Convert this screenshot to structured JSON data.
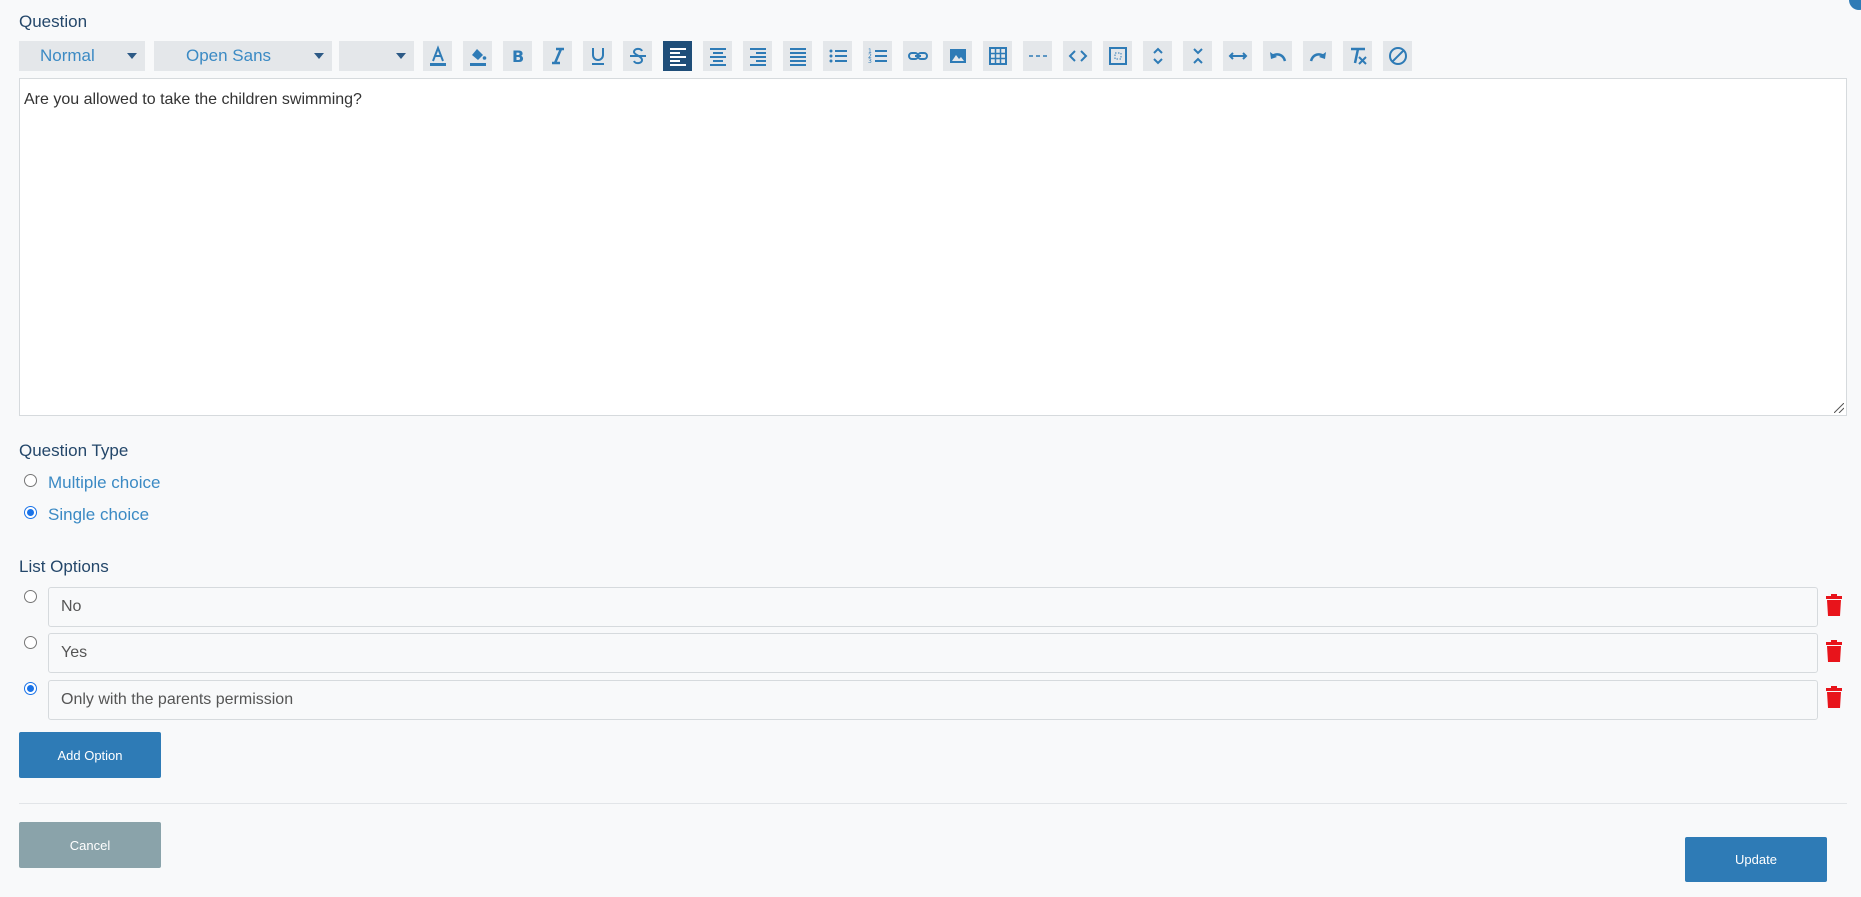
{
  "question": {
    "label": "Question",
    "text": "Are you allowed to take the children swimming?"
  },
  "toolbar": {
    "format_select": "Normal",
    "font_select": "Open Sans",
    "size_select": "",
    "buttons": [
      "text-color",
      "background-color",
      "bold",
      "italic",
      "underline",
      "strikethrough",
      "align-left",
      "align-center",
      "align-right",
      "align-justify",
      "bullet-list",
      "numbered-list",
      "link",
      "image",
      "table",
      "horizontal-rule",
      "code-view",
      "fullscreen",
      "line-height-up",
      "line-height-down",
      "width",
      "undo",
      "redo",
      "clear-format",
      "remove"
    ]
  },
  "question_type": {
    "label": "Question Type",
    "options": [
      {
        "label": "Multiple choice",
        "checked": false
      },
      {
        "label": "Single choice",
        "checked": true
      }
    ]
  },
  "list_options": {
    "label": "List Options",
    "items": [
      {
        "value": "No",
        "checked": false
      },
      {
        "value": "Yes",
        "checked": false
      },
      {
        "value": "Only with the parents permission",
        "checked": true
      }
    ],
    "add_label": "Add Option"
  },
  "actions": {
    "cancel_label": "Cancel",
    "update_label": "Update"
  },
  "colors": {
    "primary": "#2e7bb6",
    "cancel": "#8aa3aa",
    "danger": "#e8141b",
    "active_toolbar": "#1f4e79"
  }
}
